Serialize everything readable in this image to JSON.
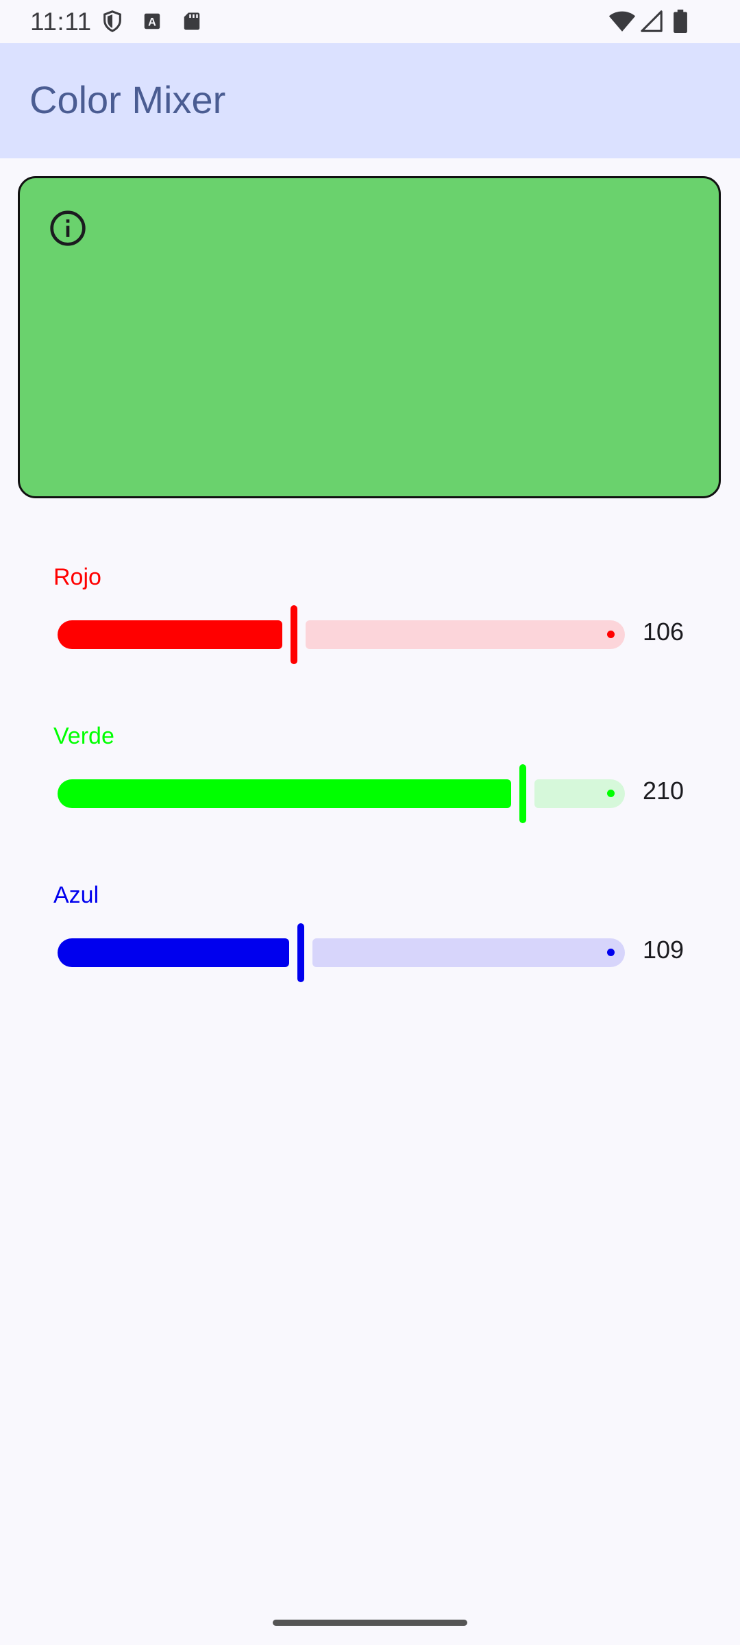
{
  "status_bar": {
    "time": "11:11",
    "left_icons": [
      "shield-icon",
      "text-a-icon",
      "sd-card-icon"
    ],
    "right_icons": [
      "wifi-icon",
      "cell-signal-icon",
      "battery-icon"
    ]
  },
  "app_bar": {
    "title": "Color Mixer"
  },
  "preview": {
    "color": "#6ad26d",
    "icon": "info-icon"
  },
  "sliders": [
    {
      "label": "Rojo",
      "value": "106",
      "max": 255,
      "color": "#ff0000",
      "track_color": "#fcd5da"
    },
    {
      "label": "Verde",
      "value": "210",
      "max": 255,
      "color": "#00ff00",
      "track_color": "#d6f8da"
    },
    {
      "label": "Azul",
      "value": "109",
      "max": 255,
      "color": "#0000ee",
      "track_color": "#d7d5fb"
    }
  ]
}
